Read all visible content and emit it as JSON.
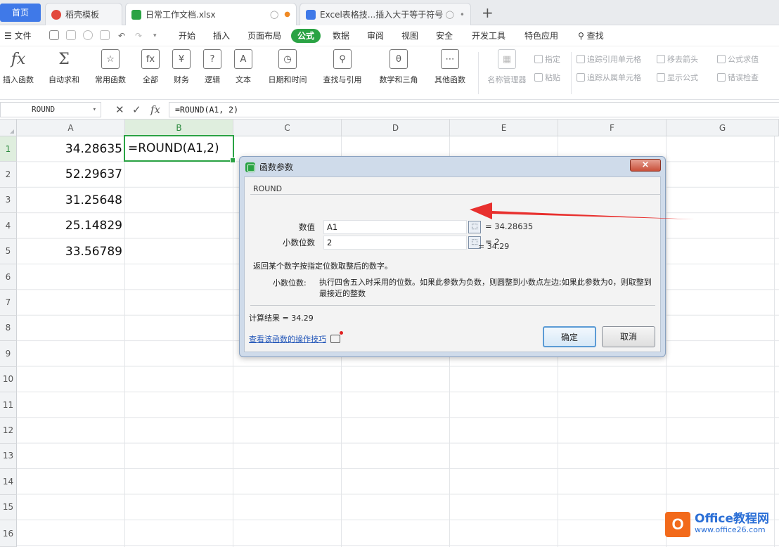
{
  "tabs": {
    "home": "首页",
    "t1": "稻壳模板",
    "t2": "日常工作文档.xlsx",
    "t3": "Excel表格技...插入大于等于符号",
    "plus": "+"
  },
  "menu": {
    "file": "文件",
    "items": [
      "开始",
      "插入",
      "页面布局",
      "公式",
      "数据",
      "审阅",
      "视图",
      "安全",
      "开发工具",
      "特色应用",
      "查找"
    ]
  },
  "ribbon": {
    "buttons": [
      "插入函数",
      "自动求和",
      "常用函数",
      "全部",
      "财务",
      "逻辑",
      "文本",
      "日期和时间",
      "查找与引用",
      "数学和三角",
      "其他函数"
    ],
    "grey": [
      "名称管理器",
      "指定",
      "粘贴",
      "追踪引用单元格",
      "追踪从属单元格",
      "移去箭头",
      "显示公式",
      "公式求值",
      "错误检查"
    ]
  },
  "formula_bar": {
    "name_box": "ROUND",
    "formula": "=ROUND(A1, 2)"
  },
  "columns": [
    "A",
    "B",
    "C",
    "D",
    "E",
    "F",
    "G"
  ],
  "rows": [
    "1",
    "2",
    "3",
    "4",
    "5",
    "6",
    "7",
    "8",
    "9",
    "10",
    "11",
    "12",
    "13",
    "14",
    "15",
    "16"
  ],
  "cells": {
    "a": [
      "34.28635",
      "52.29637",
      "31.25648",
      "25.14829",
      "33.56789"
    ],
    "b1": "=ROUND(A1,2)"
  },
  "dialog": {
    "title": "函数参数",
    "close": "×",
    "function_name": "ROUND",
    "args": [
      {
        "label": "数值",
        "value": "A1",
        "result": "= 34.28635"
      },
      {
        "label": "小数位数",
        "value": "2",
        "result": "= 2"
      }
    ],
    "result_preview": "= 34.29",
    "description": "返回某个数字按指定位数取整后的数字。",
    "param_label": "小数位数:",
    "param_desc": "执行四舍五入时采用的位数。如果此参数为负数，则圆整到小数点左边;如果此参数为0，则取整到最接近的整数",
    "calc_result_label": "计算结果 =",
    "calc_result_value": "34.29",
    "help_link": "查看该函数的操作技巧",
    "ok": "确定",
    "cancel": "取消"
  },
  "watermark": {
    "logo_letter": "O",
    "line1": "Office教程网",
    "line2": "www.office26.com"
  }
}
